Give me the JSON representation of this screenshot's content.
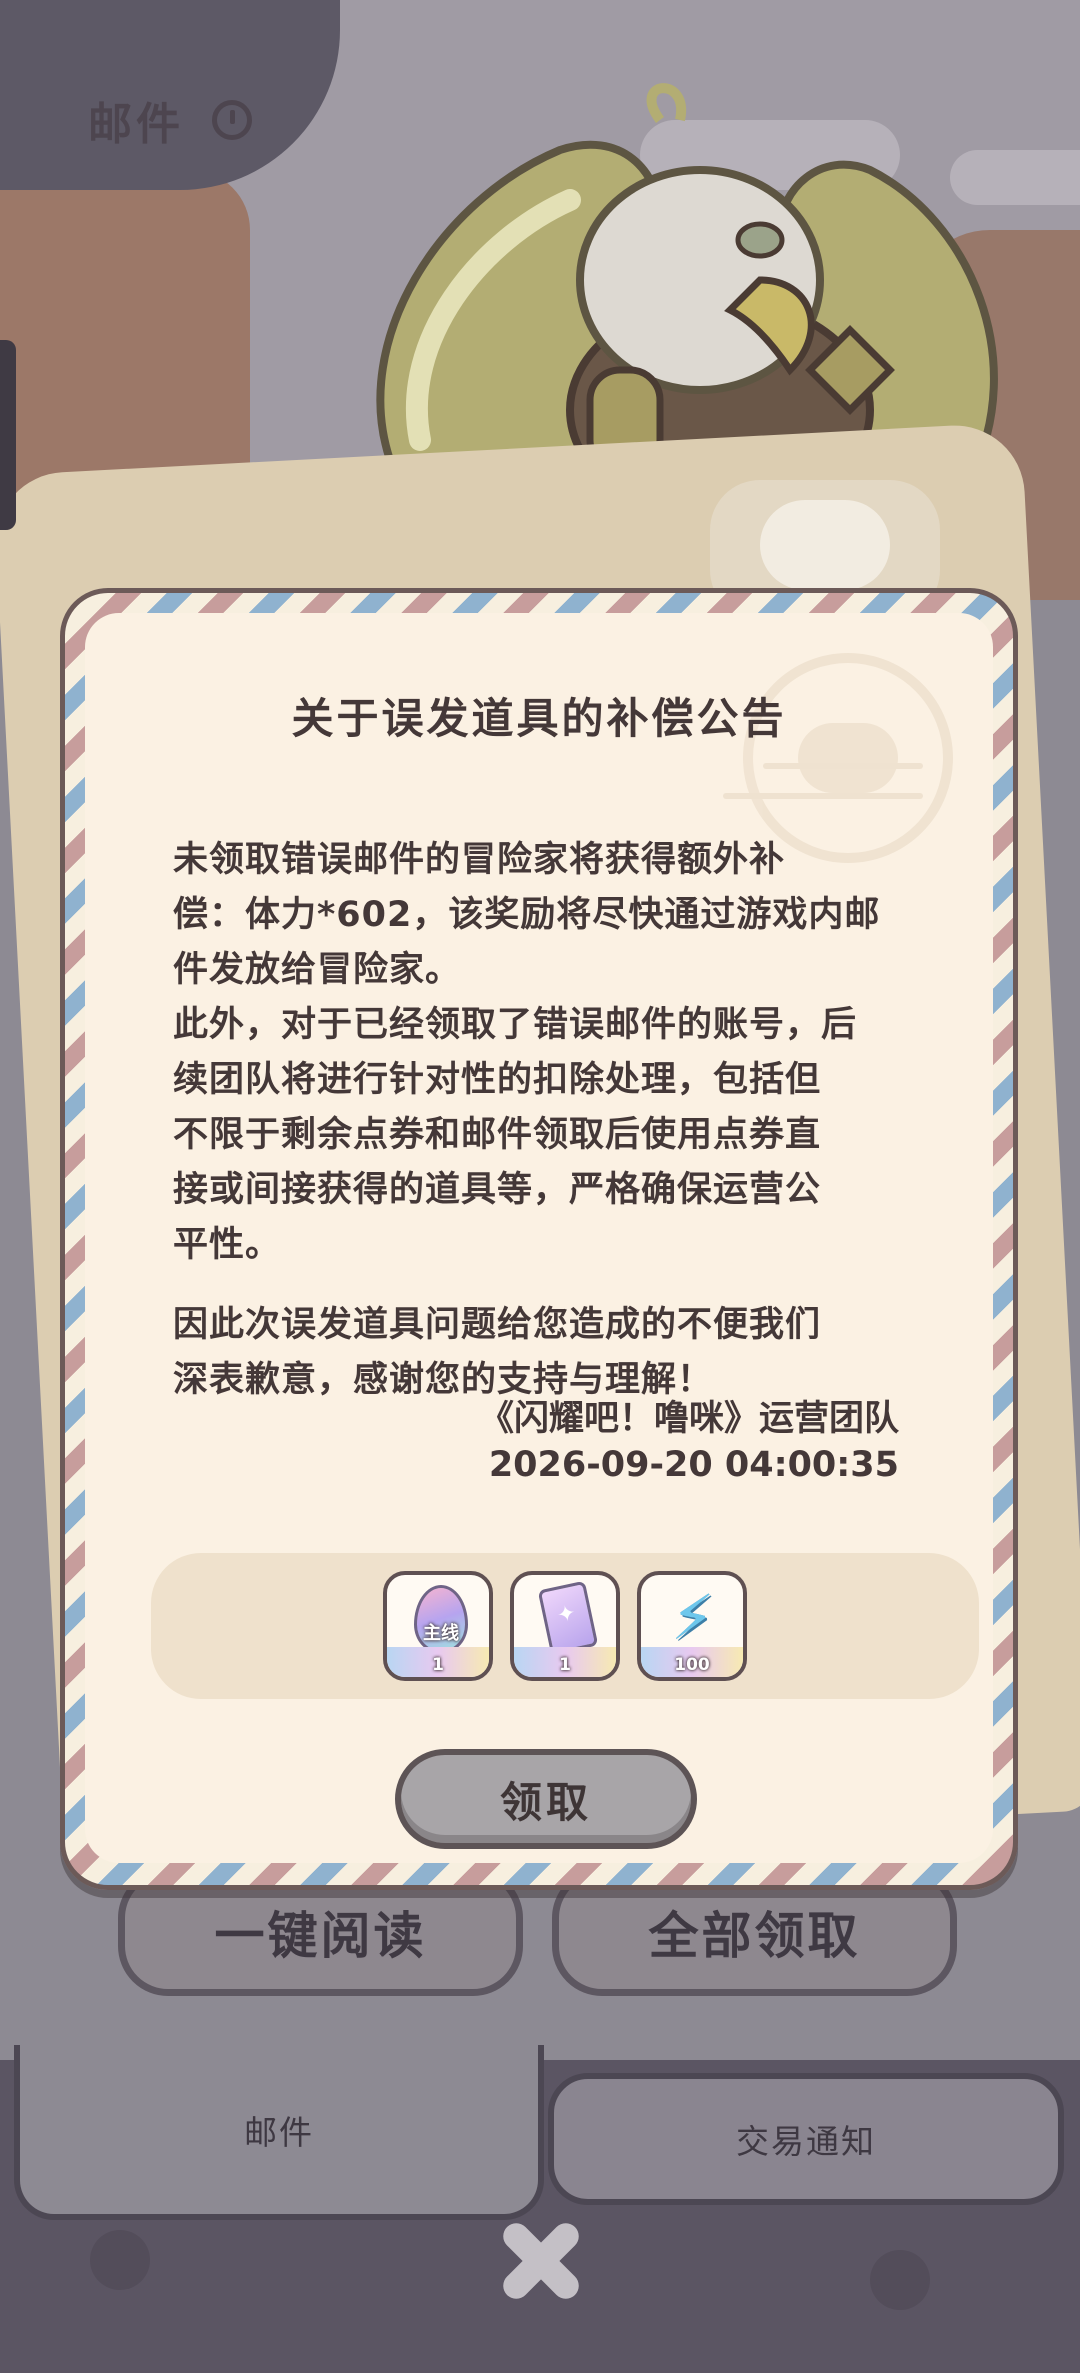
{
  "header": {
    "title": "邮件"
  },
  "dialog": {
    "title": "关于误发道具的补偿公告",
    "paragraph1": "未领取错误邮件的冒险家将获得额外补\n偿：体力*602，该奖励将尽快通过游戏内邮\n件发放给冒险家。\n此外，对于已经领取了错误邮件的账号，后\n续团队将进行针对性的扣除处理，包括但\n不限于剩余点券和邮件领取后使用点券直\n接或间接获得的道具等，严格确保运营公\n平性。",
    "paragraph2": "因此次误发道具问题给您造成的不便我们\n深表歉意，感谢您的支持与理解！",
    "signature": "《闪耀吧！噜咪》运营团队",
    "date": "2026-09-20 04:00:35",
    "rewards": [
      {
        "icon": "egg-icon",
        "label": "主线",
        "count": "1"
      },
      {
        "icon": "card-icon",
        "count": "1"
      },
      {
        "icon": "energy-bolt-icon",
        "count": "100"
      }
    ],
    "claim_label": "领取"
  },
  "actions": {
    "read_all_label": "一键阅读",
    "claim_all_label": "全部领取"
  },
  "tabs": [
    {
      "label": "邮件",
      "active": true
    },
    {
      "label": "交易通知",
      "active": false
    }
  ],
  "colors": {
    "dialog_bg": "#fbf1e3",
    "stripe_blue": "#8fb2cf",
    "stripe_red": "#c79d9c",
    "text": "#443838"
  }
}
